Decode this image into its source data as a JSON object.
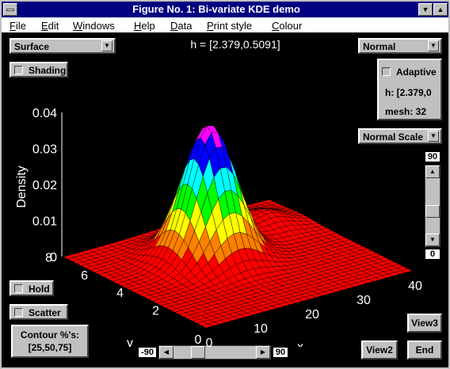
{
  "window": {
    "title": "Figure No. 1: Bi-variate KDE demo"
  },
  "menu": [
    "File",
    "Edit",
    "Windows",
    "Help",
    "Data",
    "Print style",
    "Colour"
  ],
  "plot_type": {
    "value": "Surface"
  },
  "shading": {
    "label": "Shading"
  },
  "bandwidth_text": "h = [2.379,0.5091]",
  "kernel": {
    "value": "Normal"
  },
  "adaptive_panel": {
    "adaptive_label": "Adaptive",
    "h_text": "h: [2.379,0",
    "mesh_text": "mesh: 32"
  },
  "scale": {
    "value": "Normal Scale"
  },
  "elevation": {
    "max": "90",
    "min": "0"
  },
  "azimuth": {
    "min": "-90",
    "max": "90"
  },
  "hold": {
    "label": "Hold"
  },
  "scatter": {
    "label": "Scatter"
  },
  "contour": {
    "label": "Contour %'s:",
    "values": "[25,50,75]"
  },
  "buttons": {
    "view3": "View3",
    "view2": "View2",
    "end": "End"
  },
  "chart_data": {
    "type": "surface",
    "zlabel": "Density",
    "xlabel": "x",
    "ylabel": "y",
    "z_ticks": [
      "0.04",
      "0.03",
      "0.02",
      "0.01",
      "0"
    ],
    "x_ticks": [
      "0",
      "10",
      "20",
      "30",
      "40"
    ],
    "y_ticks": [
      "2",
      "4",
      "6",
      "8"
    ],
    "y_zero_tick": "0",
    "zlim": [
      0,
      0.04
    ],
    "xlim": [
      0,
      40
    ],
    "ylim": [
      0,
      8
    ],
    "peak": {
      "x": 18,
      "y": 5,
      "density": 0.037
    },
    "colormap": [
      "#ff0000",
      "#ff8000",
      "#ffff00",
      "#00ff00",
      "#00ffff",
      "#0000ff",
      "#ff00ff"
    ]
  }
}
